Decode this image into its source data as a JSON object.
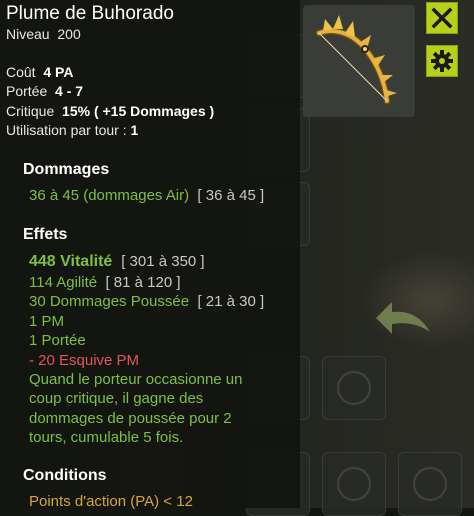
{
  "item": {
    "name": "Plume de Buhorado",
    "level_label": "Niveau",
    "level": "200"
  },
  "stats": {
    "cost_label": "Coût",
    "cost_value": "4 PA",
    "range_label": "Portée",
    "range_value": "4 - 7",
    "crit_label": "Critique",
    "crit_value": "15% ( +15 Dommages )",
    "uses_label": "Utilisation par tour :",
    "uses_value": "1"
  },
  "damage": {
    "heading": "Dommages",
    "main": "36 à 45 (dommages Air)",
    "range": "[ 36 à 45 ]"
  },
  "effects": {
    "heading": "Effets",
    "items": [
      {
        "text": "448 Vitalité",
        "range": "[ 301 à 350 ]"
      },
      {
        "text": "114 Agilité",
        "range": "[ 81 à 120 ]"
      },
      {
        "text": "30 Dommages Poussée",
        "range": "[ 21 à 30 ]"
      },
      {
        "text": "1 PM",
        "range": ""
      },
      {
        "text": "1 Portée",
        "range": ""
      }
    ],
    "negative": "- 20 Esquive PM",
    "special": [
      "Quand le porteur occasionne un",
      "coup critique, il gagne des",
      "dommages de poussée pour 2",
      "tours, cumulable 5 fois."
    ]
  },
  "conditions": {
    "heading": "Conditions",
    "first": "Points d'action (PA) < 12"
  },
  "buttons": {
    "close_icon": "close-icon",
    "settings_icon": "gear-icon"
  },
  "colors": {
    "accent": "#b7d01a",
    "effect_green": "#7cc043",
    "negative_red": "#e85454"
  }
}
